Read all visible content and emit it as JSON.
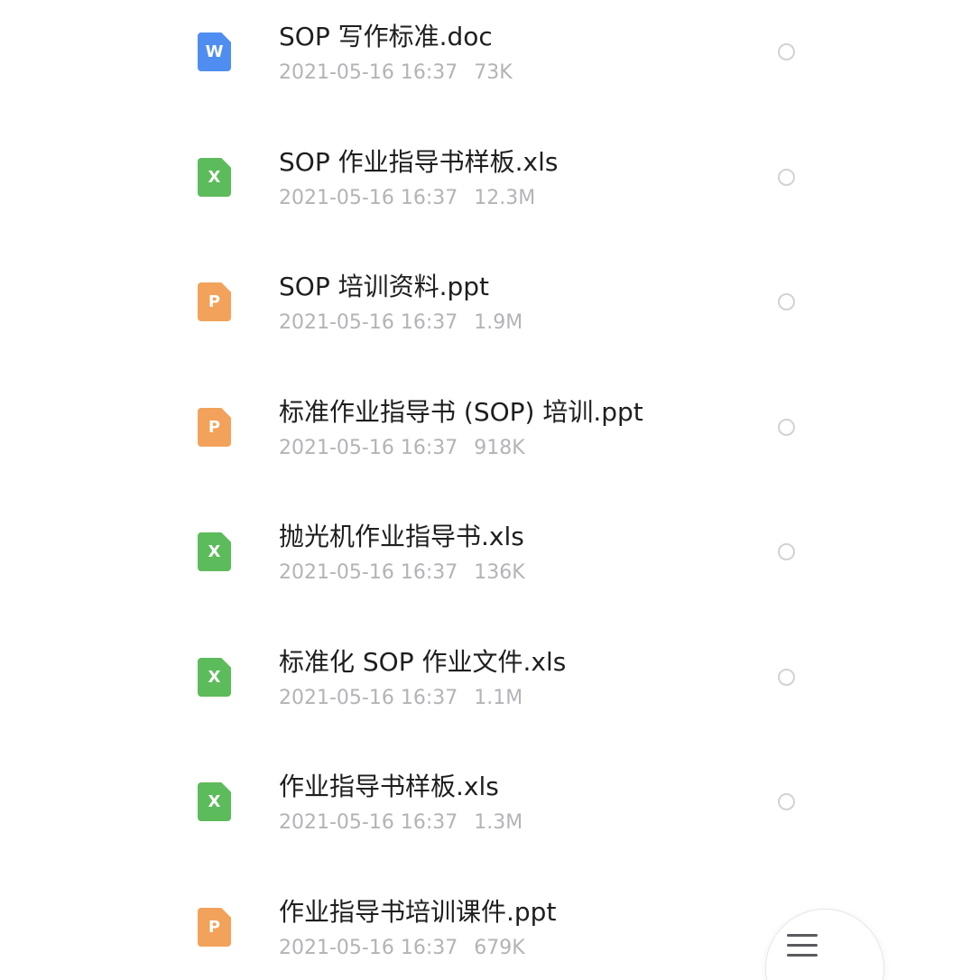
{
  "files": [
    {
      "name": "SOP 写作标准.doc",
      "date": "2021-05-16 16:37",
      "size": "73K",
      "type": "doc",
      "icon_letter": "W",
      "icon": "word-doc-icon",
      "color": "#4f8ef0"
    },
    {
      "name": "SOP 作业指导书样板.xls",
      "date": "2021-05-16 16:37",
      "size": "12.3M",
      "type": "xls",
      "icon_letter": "X",
      "icon": "excel-xls-icon",
      "color": "#5cbb5a"
    },
    {
      "name": "SOP 培训资料.ppt",
      "date": "2021-05-16 16:37",
      "size": "1.9M",
      "type": "ppt",
      "icon_letter": "P",
      "icon": "powerpoint-ppt-icon",
      "color": "#f2a25a"
    },
    {
      "name": "标准作业指导书 (SOP) 培训.ppt",
      "date": "2021-05-16 16:37",
      "size": "918K",
      "type": "ppt",
      "icon_letter": "P",
      "icon": "powerpoint-ppt-icon",
      "color": "#f2a25a"
    },
    {
      "name": "抛光机作业指导书.xls",
      "date": "2021-05-16 16:37",
      "size": "136K",
      "type": "xls",
      "icon_letter": "X",
      "icon": "excel-xls-icon",
      "color": "#5cbb5a"
    },
    {
      "name": "标准化 SOP 作业文件.xls",
      "date": "2021-05-16 16:37",
      "size": "1.1M",
      "type": "xls",
      "icon_letter": "X",
      "icon": "excel-xls-icon",
      "color": "#5cbb5a"
    },
    {
      "name": "作业指导书样板.xls",
      "date": "2021-05-16 16:37",
      "size": "1.3M",
      "type": "xls",
      "icon_letter": "X",
      "icon": "excel-xls-icon",
      "color": "#5cbb5a"
    },
    {
      "name": "作业指导书培训课件.ppt",
      "date": "2021-05-16 16:37",
      "size": "679K",
      "type": "ppt",
      "icon_letter": "P",
      "icon": "powerpoint-ppt-icon",
      "color": "#f2a25a"
    }
  ],
  "menu_button": {
    "icon": "hamburger-menu-icon"
  },
  "colors": {
    "title_text": "#1e1e1e",
    "meta_text": "#b3b3b8",
    "radio_border": "#d2d2d6"
  }
}
